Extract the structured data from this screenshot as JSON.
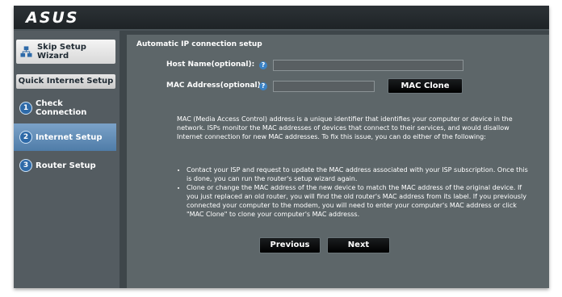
{
  "header": {
    "logo_text": "ASUS"
  },
  "sidebar": {
    "skip_label": "Skip Setup Wizard",
    "section_label": "Quick Internet Setup",
    "steps": [
      {
        "num": "1",
        "label": "Check Connection"
      },
      {
        "num": "2",
        "label": "Internet Setup"
      },
      {
        "num": "3",
        "label": "Router Setup"
      }
    ]
  },
  "main": {
    "section_title": "Automatic IP connection setup",
    "host_label": "Host Name(optional):",
    "host_value": "",
    "mac_label": "MAC Address(optional)",
    "mac_value": "",
    "help_glyph": "?",
    "mac_clone_label": "MAC Clone",
    "description": "MAC (Media Access Control) address is a unique identifier that identifies your computer or device in the network. ISPs monitor the MAC addresses of devices that connect to their services, and would disallow Internet connection for new MAC addresses. To fix this issue, you can do either of the following:",
    "bullets": [
      "Contact your ISP and request to update the MAC address associated with your ISP subscription. Once this is done, you can run the router's setup wizard again.",
      "Clone or change the MAC address of the new device to match the MAC address of the original device. If you just replaced an old router, you will find the old router's MAC address from its label. If you previously connected your computer to the modem, you will need to enter your computer's MAC address or click \"MAC Clone\" to clone your computer's MAC addresss."
    ],
    "previous_label": "Previous",
    "next_label": "Next"
  }
}
